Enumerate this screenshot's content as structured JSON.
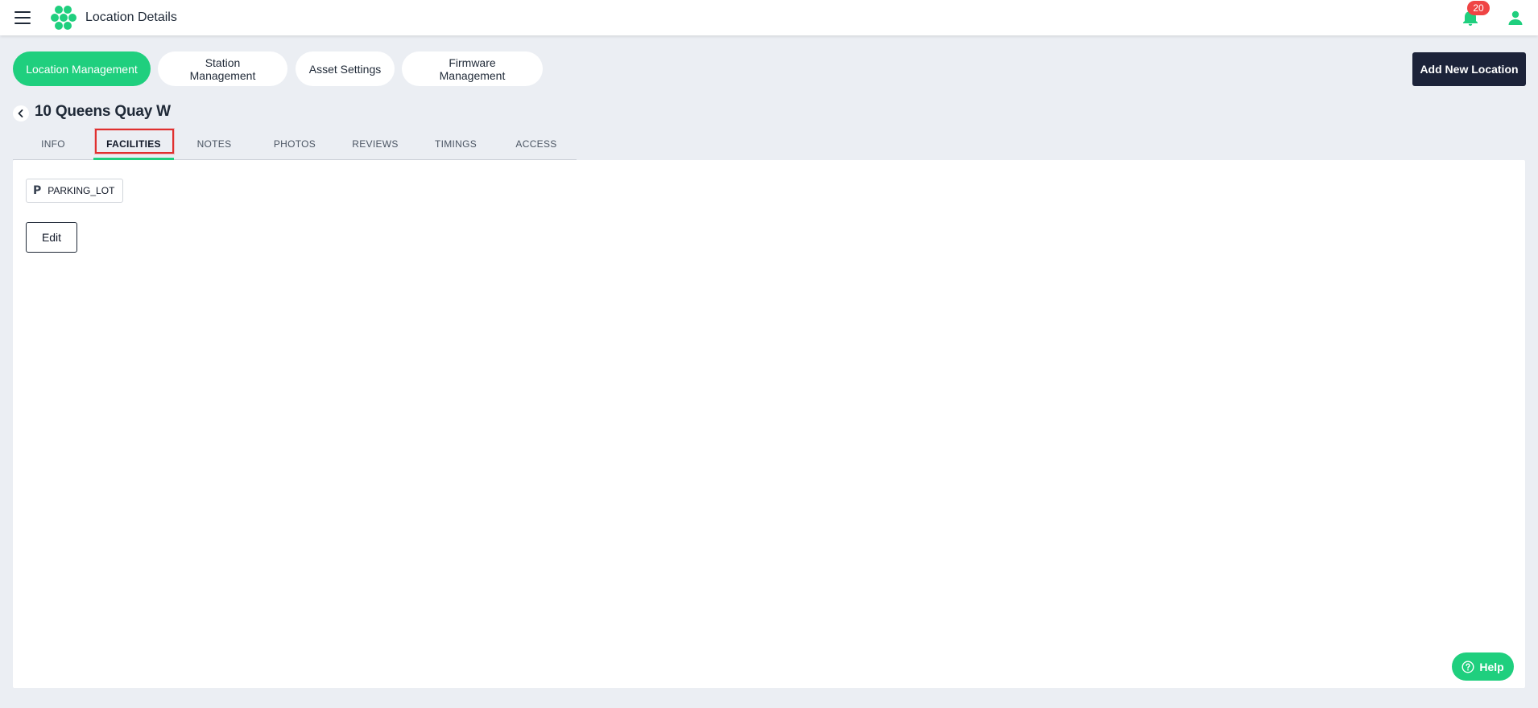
{
  "header": {
    "title": "Location Details",
    "notification_count": "20"
  },
  "nav": {
    "pills": [
      {
        "label": "Location Management",
        "active": true
      },
      {
        "label": "Station Management",
        "active": false
      },
      {
        "label": "Asset Settings",
        "active": false
      },
      {
        "label": "Firmware Management",
        "active": false
      }
    ],
    "add_location_label": "Add New Location"
  },
  "location": {
    "title": "10 Queens Quay W"
  },
  "tabs": [
    {
      "label": "INFO"
    },
    {
      "label": "FACILITIES"
    },
    {
      "label": "NOTES"
    },
    {
      "label": "PHOTOS"
    },
    {
      "label": "REVIEWS"
    },
    {
      "label": "TIMINGS"
    },
    {
      "label": "ACCESS"
    }
  ],
  "active_tab": "FACILITIES",
  "facilities": {
    "items": [
      {
        "icon_text": "P",
        "icon": "parking-icon",
        "label": "PARKING_LOT"
      }
    ],
    "edit_label": "Edit"
  },
  "help": {
    "label": "Help"
  },
  "colors": {
    "accent": "#1fcf7e",
    "dark_button": "#1c2339",
    "badge": "#ef4444",
    "highlight": "#e0302f"
  }
}
